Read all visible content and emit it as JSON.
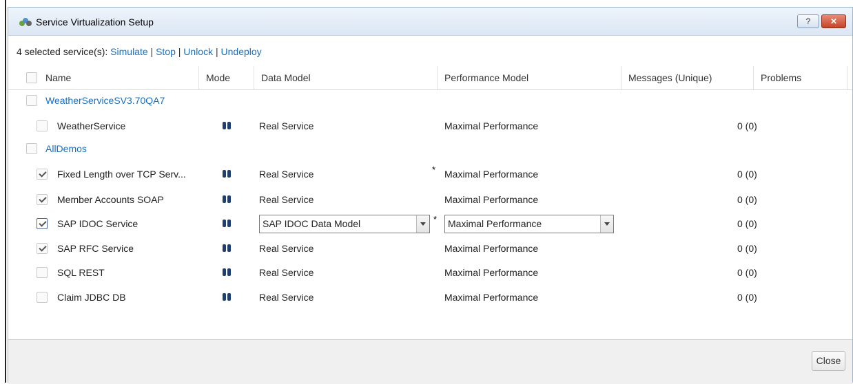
{
  "window": {
    "title": "Service Virtualization Setup",
    "help_label": "?",
    "close_label": "✕"
  },
  "actions": {
    "prefix": "4 selected service(s):",
    "simulate": "Simulate",
    "stop": "Stop",
    "unlock": "Unlock",
    "undeploy": "Undeploy",
    "separator": "|"
  },
  "columns": [
    "Name",
    "Mode",
    "Data Model",
    "Performance Model",
    "Messages (Unique)",
    "Problems"
  ],
  "groups": [
    {
      "name": "WeatherServiceSV3.70QA7",
      "services": [
        {
          "name": "WeatherService",
          "mode_icon": "simulate-mode-icon",
          "data_model": "Real Service",
          "perf_model": "Maximal Performance",
          "messages": "0 (0)",
          "checked": false
        }
      ]
    },
    {
      "name": "AllDemos",
      "services": [
        {
          "name": "Fixed Length over TCP Serv...",
          "mode_icon": "simulate-mode-icon",
          "data_model": "Real Service",
          "perf_model": "Maximal Performance",
          "messages": "0 (0)",
          "checked": true,
          "asterisk": "*"
        },
        {
          "name": "Member Accounts SOAP",
          "mode_icon": "simulate-mode-icon",
          "data_model": "Real Service",
          "perf_model": "Maximal Performance",
          "messages": "0 (0)",
          "checked": true
        },
        {
          "name": "SAP IDOC Service",
          "mode_icon": "simulate-mode-icon",
          "data_model": "SAP IDOC Data Model",
          "perf_model": "Maximal Performance",
          "messages": "0 (0)",
          "checked": true,
          "editing": true,
          "asterisk": "*"
        },
        {
          "name": "SAP RFC Service",
          "mode_icon": "simulate-mode-icon",
          "data_model": "Real Service",
          "perf_model": "Maximal Performance",
          "messages": "0 (0)",
          "checked": true
        },
        {
          "name": "SQL REST",
          "mode_icon": "simulate-mode-icon",
          "data_model": "Real Service",
          "perf_model": "Maximal Performance",
          "messages": "0 (0)",
          "checked": false
        },
        {
          "name": "Claim JDBC DB",
          "mode_icon": "simulate-mode-icon",
          "data_model": "Real Service",
          "perf_model": "Maximal Performance",
          "messages": "0 (0)",
          "checked": false
        }
      ]
    }
  ],
  "footer": {
    "close_label": "Close"
  },
  "colors": {
    "link": "#1a6fbf",
    "mode_icon": "#1e3f6e"
  }
}
